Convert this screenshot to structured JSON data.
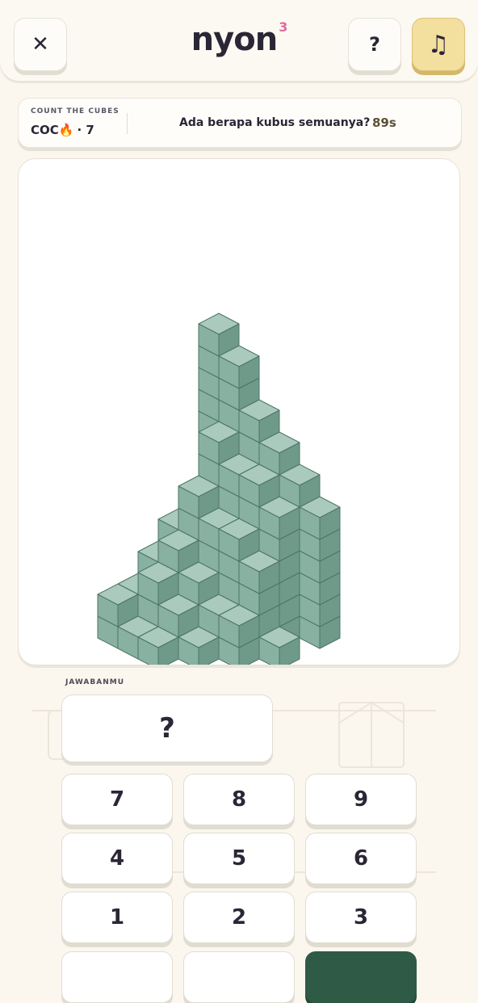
{
  "header": {
    "logo_text": "nyon",
    "logo_sup": "3",
    "close_icon": "✕",
    "help_label": "?",
    "music_icon": "♫"
  },
  "info": {
    "mode_label": "COUNT THE CUBES",
    "streak_prefix": "COC",
    "streak_icon": "🔥",
    "streak_value": "· 7",
    "question": "Ada berapa kubus semuanya?",
    "timer": "89s"
  },
  "colors": {
    "cube_top": "#a9cabc",
    "cube_left": "#89b1a2",
    "cube_right": "#6f9a8a",
    "cube_edge": "#4d7566",
    "accent": "#2f5a45"
  },
  "answer": {
    "label": "JAWABANMU",
    "value": "?"
  },
  "keypad": {
    "keys": [
      "7",
      "8",
      "9",
      "4",
      "5",
      "6",
      "1",
      "2",
      "3"
    ]
  }
}
